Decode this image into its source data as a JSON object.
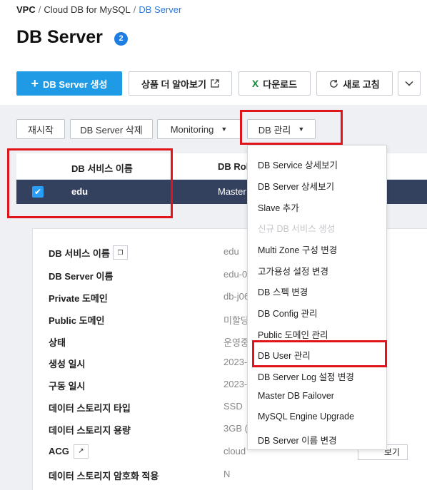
{
  "breadcrumb": {
    "items": [
      "VPC",
      "Cloud DB for MySQL",
      "DB Server"
    ],
    "separator": "/"
  },
  "page": {
    "title": "DB Server",
    "count": "2"
  },
  "toolbar": {
    "create_label": "DB Server 생성",
    "learn_label": "상품 더 알아보기",
    "download_label": "다운로드",
    "refresh_label": "새로 고침"
  },
  "actions": {
    "restart": "재시작",
    "delete": "DB Server 삭제",
    "monitoring": "Monitoring",
    "db_manage": "DB 관리"
  },
  "table": {
    "headers": [
      "DB 서비스 이름",
      "DB Role"
    ],
    "row": {
      "service_name": "edu",
      "role": "Master"
    }
  },
  "details": [
    {
      "label": "DB 서비스 이름",
      "value": "edu"
    },
    {
      "label": "DB Server 이름",
      "value": "edu-0"
    },
    {
      "label": "Private 도메인",
      "value": "db-j06"
    },
    {
      "label": "Public 도메인",
      "value": "미할당"
    },
    {
      "label": "상태",
      "value": "운영중"
    },
    {
      "label": "생성 일시",
      "value": "2023-"
    },
    {
      "label": "구동 일시",
      "value": "2023-"
    },
    {
      "label": "데이터 스토리지 타입",
      "value": "SSD"
    },
    {
      "label": "데이터 스토리지 용량",
      "value": "3GB ("
    },
    {
      "label": "ACG",
      "value": "cloud"
    },
    {
      "label": "데이터 스토리지 암호화 적용",
      "value": "N"
    }
  ],
  "view_button": "보기",
  "dropdown": {
    "items": [
      "DB Service 상세보기",
      "DB Server 상세보기",
      "Slave 추가",
      "신규 DB 서비스 생성",
      "Multi Zone 구성 변경",
      "고가용성 설정 변경",
      "DB 스펙 변경",
      "DB Config 관리",
      "Public 도메인 관리",
      "DB User 관리",
      "DB Server Log 설정 변경",
      "Master DB Failover",
      "MySQL Engine Upgrade",
      "DB Server 이름 변경"
    ],
    "disabled_index": 3
  },
  "colors": {
    "primary": "#1f9be6",
    "selected_row": "#34415e",
    "highlight": "#e0141b",
    "link": "#2a7ae4"
  },
  "icons": [
    "plus-icon",
    "external-link-icon",
    "excel-icon",
    "refresh-icon",
    "chevron-down-icon",
    "checkbox-icon",
    "copy-icon"
  ]
}
